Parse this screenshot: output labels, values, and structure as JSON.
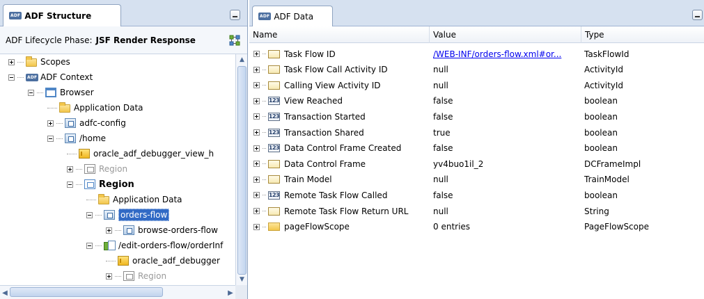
{
  "left_panel": {
    "tab_badge": "ADF",
    "tab_title": "ADF Structure",
    "phase_label": "ADF Lifecycle Phase:",
    "phase_value": "JSF Render Response",
    "tree": [
      {
        "label": "Scopes",
        "expander": "plus",
        "icon": "folder-icon",
        "style": "normal"
      },
      {
        "label": "ADF Context",
        "expander": "minus",
        "icon": "adf-icon",
        "style": "normal"
      },
      {
        "label": "Browser",
        "expander": "minus",
        "icon": "browser-icon",
        "style": "normal"
      },
      {
        "label": "Application Data",
        "expander": "none",
        "icon": "folder-icon",
        "style": "normal"
      },
      {
        "label": "adfc-config",
        "expander": "plus",
        "icon": "task-flow-icon",
        "style": "normal"
      },
      {
        "label": "/home",
        "expander": "minus",
        "icon": "task-flow-icon",
        "style": "normal"
      },
      {
        "label": "oracle_adf_debugger_view_h",
        "expander": "none",
        "icon": "page-icon",
        "style": "normal"
      },
      {
        "label": "Region",
        "expander": "plus",
        "icon": "region-icon",
        "style": "grey"
      },
      {
        "label": "Region",
        "expander": "minus",
        "icon": "region-icon",
        "style": "bold"
      },
      {
        "label": "Application Data",
        "expander": "none",
        "icon": "folder-icon",
        "style": "normal"
      },
      {
        "label": "orders-flow",
        "expander": "minus",
        "icon": "task-flow-icon",
        "style": "selected"
      },
      {
        "label": "browse-orders-flow",
        "expander": "plus",
        "icon": "task-flow-icon",
        "style": "normal"
      },
      {
        "label": "/edit-orders-flow/orderInf",
        "expander": "minus",
        "icon": "activity-icon",
        "style": "normal"
      },
      {
        "label": "oracle_adf_debugger",
        "expander": "none",
        "icon": "page-icon",
        "style": "normal"
      },
      {
        "label": "Region",
        "expander": "plus",
        "icon": "region-icon",
        "style": "grey"
      }
    ]
  },
  "right_panel": {
    "tab_badge": "ADF",
    "tab_title": "ADF Data",
    "columns": [
      "Name",
      "Value",
      "Type"
    ],
    "rows": [
      {
        "name": "Task Flow ID",
        "icon": "object-icon",
        "value": "/WEB-INF/orders-flow.xml#or...",
        "value_is_link": true,
        "type": "TaskFlowId"
      },
      {
        "name": "Task Flow Call Activity ID",
        "icon": "object-icon",
        "value": "null",
        "value_is_link": false,
        "type": "ActivityId"
      },
      {
        "name": "Calling View Activity ID",
        "icon": "object-icon",
        "value": "null",
        "value_is_link": false,
        "type": "ActivityId"
      },
      {
        "name": "View Reached",
        "icon": "number-icon",
        "value": "false",
        "value_is_link": false,
        "type": "boolean"
      },
      {
        "name": "Transaction Started",
        "icon": "number-icon",
        "value": "false",
        "value_is_link": false,
        "type": "boolean"
      },
      {
        "name": "Transaction Shared",
        "icon": "number-icon",
        "value": "true",
        "value_is_link": false,
        "type": "boolean"
      },
      {
        "name": "Data Control Frame Created",
        "icon": "number-icon",
        "value": "false",
        "value_is_link": false,
        "type": "boolean"
      },
      {
        "name": "Data Control Frame",
        "icon": "object-icon",
        "value": "yv4buo1il_2",
        "value_is_link": false,
        "type": "DCFrameImpl"
      },
      {
        "name": "Train Model",
        "icon": "object-icon",
        "value": "null",
        "value_is_link": false,
        "type": "TrainModel"
      },
      {
        "name": "Remote Task Flow Called",
        "icon": "number-icon",
        "value": "false",
        "value_is_link": false,
        "type": "boolean"
      },
      {
        "name": "Remote Task Flow Return URL",
        "icon": "object-icon",
        "value": "null",
        "value_is_link": false,
        "type": "String"
      },
      {
        "name": "pageFlowScope",
        "icon": "folder-icon",
        "value": "0 entries",
        "value_is_link": false,
        "type": "PageFlowScope"
      }
    ],
    "number_icon_text": "123"
  }
}
